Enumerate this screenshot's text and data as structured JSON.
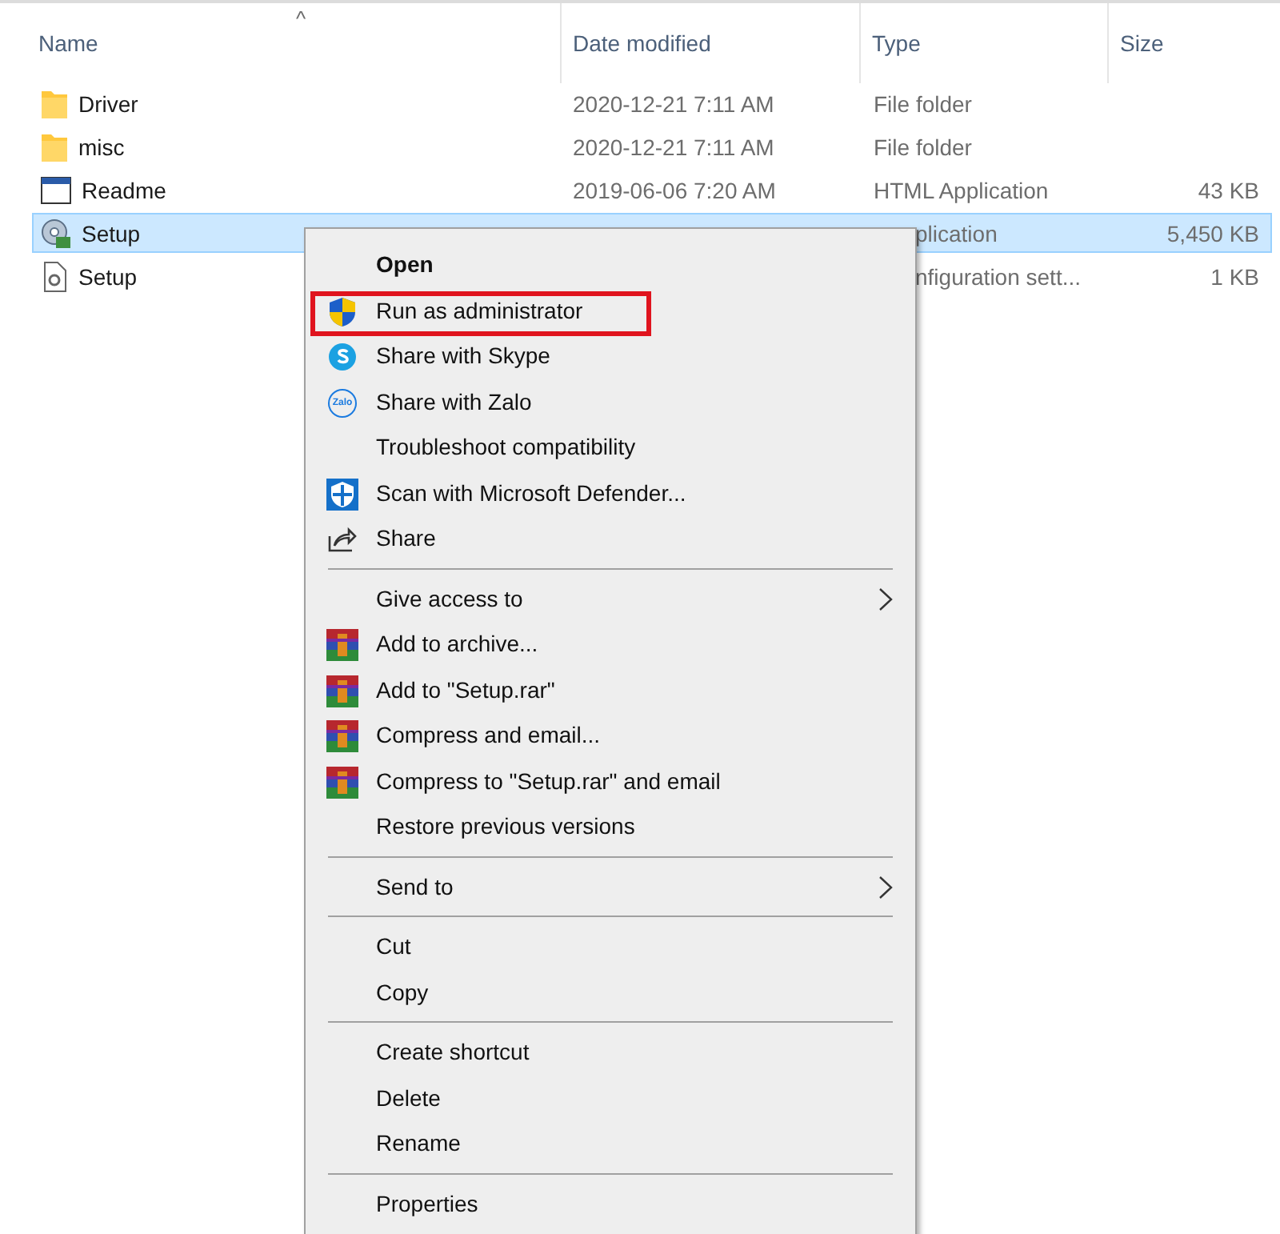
{
  "columns": [
    {
      "label": "Name",
      "sorted": true
    },
    {
      "label": "Date modified",
      "sorted": false
    },
    {
      "label": "Type",
      "sorted": false
    },
    {
      "label": "Size",
      "sorted": false
    }
  ],
  "sort_indicator": "^",
  "files": [
    {
      "name": "Driver",
      "kind": "folder",
      "date": "2020-12-21 7:11 AM",
      "type": "File folder",
      "selected": false,
      "covered": false
    },
    {
      "name": "misc",
      "kind": "folder",
      "date": "2020-12-21 7:11 AM",
      "type": "File folder",
      "selected": false,
      "covered": false
    },
    {
      "name": "Readme",
      "kind": "window",
      "date": "2019-06-06 7:20 AM",
      "type": "HTML Application",
      "size": "43 KB",
      "selected": false,
      "covered": false
    },
    {
      "name": "Setup",
      "kind": "installer",
      "type": "plication",
      "size": "5,450 KB",
      "selected": true,
      "covered": true
    },
    {
      "name": "Setup",
      "kind": "config",
      "type": "nfiguration sett...",
      "size": "1 KB",
      "selected": false,
      "covered": true
    }
  ],
  "context_menu": {
    "groups": [
      [
        {
          "label": "Open",
          "kind": "plain",
          "bold": true,
          "highlighted": false,
          "submenu": false
        },
        {
          "label": "Run as administrator",
          "kind": "shield",
          "bold": false,
          "highlighted": true,
          "submenu": false
        },
        {
          "label": "Share with Skype",
          "kind": "skype",
          "bold": false,
          "highlighted": false,
          "submenu": false
        },
        {
          "label": "Share with Zalo",
          "kind": "zalo",
          "icon_text": "Zalo",
          "bold": false,
          "highlighted": false,
          "submenu": false
        },
        {
          "label": "Troubleshoot compatibility",
          "kind": "plain",
          "bold": false,
          "highlighted": false,
          "submenu": false
        },
        {
          "label": "Scan with Microsoft Defender...",
          "kind": "defender",
          "bold": false,
          "highlighted": false,
          "submenu": false
        },
        {
          "label": "Share",
          "kind": "share",
          "bold": false,
          "highlighted": false,
          "submenu": false
        }
      ],
      [
        {
          "label": "Give access to",
          "kind": "plain",
          "bold": false,
          "highlighted": false,
          "submenu": true
        },
        {
          "label": "Add to archive...",
          "kind": "archive",
          "bold": false,
          "highlighted": false,
          "submenu": false
        },
        {
          "label": "Add to \"Setup.rar\"",
          "kind": "archive",
          "bold": false,
          "highlighted": false,
          "submenu": false
        },
        {
          "label": "Compress and email...",
          "kind": "archive",
          "bold": false,
          "highlighted": false,
          "submenu": false
        },
        {
          "label": "Compress to \"Setup.rar\" and email",
          "kind": "archive",
          "bold": false,
          "highlighted": false,
          "submenu": false
        },
        {
          "label": "Restore previous versions",
          "kind": "plain",
          "bold": false,
          "highlighted": false,
          "submenu": false
        }
      ],
      [
        {
          "label": "Send to",
          "kind": "plain",
          "bold": false,
          "highlighted": false,
          "submenu": true
        }
      ],
      [
        {
          "label": "Cut",
          "kind": "plain",
          "bold": false,
          "highlighted": false,
          "submenu": false
        },
        {
          "label": "Copy",
          "kind": "plain",
          "bold": false,
          "highlighted": false,
          "submenu": false
        }
      ],
      [
        {
          "label": "Create shortcut",
          "kind": "plain",
          "bold": false,
          "highlighted": false,
          "submenu": false
        },
        {
          "label": "Delete",
          "kind": "plain",
          "bold": false,
          "highlighted": false,
          "submenu": false
        },
        {
          "label": "Rename",
          "kind": "plain",
          "bold": false,
          "highlighted": false,
          "submenu": false
        }
      ],
      [
        {
          "label": "Properties",
          "kind": "plain",
          "bold": false,
          "highlighted": false,
          "submenu": false
        }
      ]
    ]
  }
}
